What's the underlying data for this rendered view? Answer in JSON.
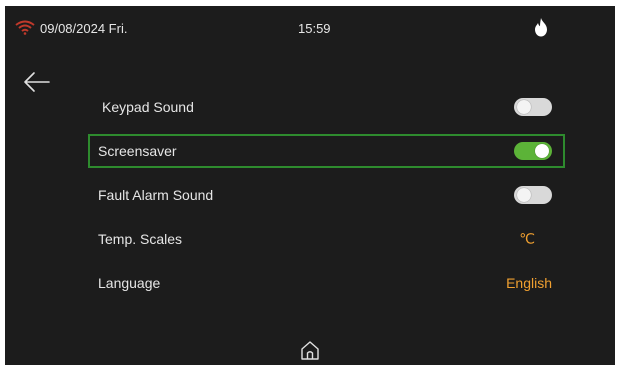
{
  "status_bar": {
    "date": "09/08/2024 Fri.",
    "time": "15:59",
    "wifi_icon": "wifi-icon",
    "flame_icon": "flame-icon",
    "wifi_color": "#c0392b"
  },
  "navigation": {
    "back_icon": "arrow-left-icon",
    "home_icon": "home-icon"
  },
  "settings": {
    "keypad_sound": {
      "label": "Keypad Sound",
      "toggle": "off"
    },
    "screensaver": {
      "label": "Screensaver",
      "toggle": "on",
      "selected": true
    },
    "fault_alarm_sound": {
      "label": "Fault Alarm Sound",
      "toggle": "off"
    },
    "temp_scales": {
      "label": "Temp. Scales",
      "value": "℃"
    },
    "language": {
      "label": "Language",
      "value": "English"
    }
  },
  "colors": {
    "background": "#1c1c1c",
    "accent_value": "#f0a030",
    "toggle_on": "#5cb338",
    "toggle_off": "#d9d9d9",
    "selection_border": "#2e8b2e"
  }
}
